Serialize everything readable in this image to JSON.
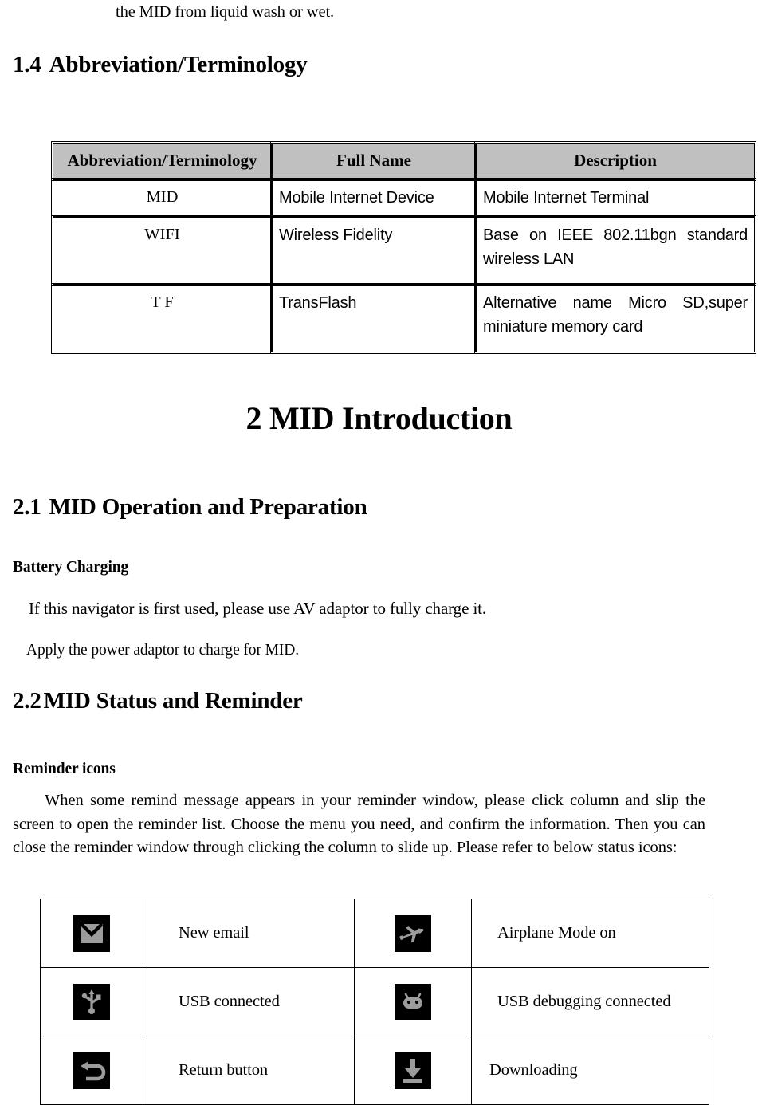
{
  "document": {
    "continuation_line": "the MID from liquid wash or wet.",
    "headings": {
      "sec_1_4_num": "1.4",
      "sec_1_4_text": "Abbreviation/Terminology",
      "chapter_2_title": "2 MID Introduction",
      "sec_2_1_num": "2.1",
      "sec_2_1_text": "MID Operation and Preparation",
      "sec_2_2_num": "2.2",
      "sec_2_2_text": "MID Status and Reminder"
    },
    "minor_headings": {
      "battery_charging": "Battery Charging",
      "reminder_icons": "Reminder icons"
    },
    "body": {
      "charge_line_1": "If this navigator is first used, please use AV adaptor to fully charge it.",
      "charge_line_2": "Apply the power adaptor to charge for MID.",
      "reminder_paragraph": "When some remind message appears in your reminder window, please click column and slip the screen to open the reminder list. Choose the menu you need, and confirm the information. Then you can close the reminder window through clicking the column to slide up. Please refer to below status icons:"
    }
  },
  "abbreviation_table": {
    "headers": [
      "Abbreviation/Terminology",
      "Full Name",
      "Description"
    ],
    "header_background": "#c0c0c0",
    "rows": [
      {
        "abbreviation": "MID",
        "full_name": "Mobile Internet Device",
        "description": "Mobile Internet Terminal"
      },
      {
        "abbreviation": "WIFI",
        "full_name": "Wireless Fidelity",
        "description": "Base on IEEE 802.11bgn standard wireless LAN"
      },
      {
        "abbreviation": "T F",
        "full_name": "TransFlash",
        "description": "Alternative name Micro SD,super miniature memory card"
      }
    ]
  },
  "reminder_icon_table": {
    "rows": [
      {
        "left_icon": "new-email-icon",
        "left_label": "New email",
        "right_icon": "airplane-mode-icon",
        "right_label": "Airplane Mode on"
      },
      {
        "left_icon": "usb-connected-icon",
        "left_label": "USB connected",
        "right_icon": "android-usb-debugging-icon",
        "right_label": "USB debugging connected"
      },
      {
        "left_icon": "return-button-icon",
        "left_label": "Return button",
        "right_icon": "downloading-icon",
        "right_label": "Downloading"
      }
    ],
    "icon_tile_background": "#000000",
    "icon_glyph_color": "#a0a0a0"
  }
}
